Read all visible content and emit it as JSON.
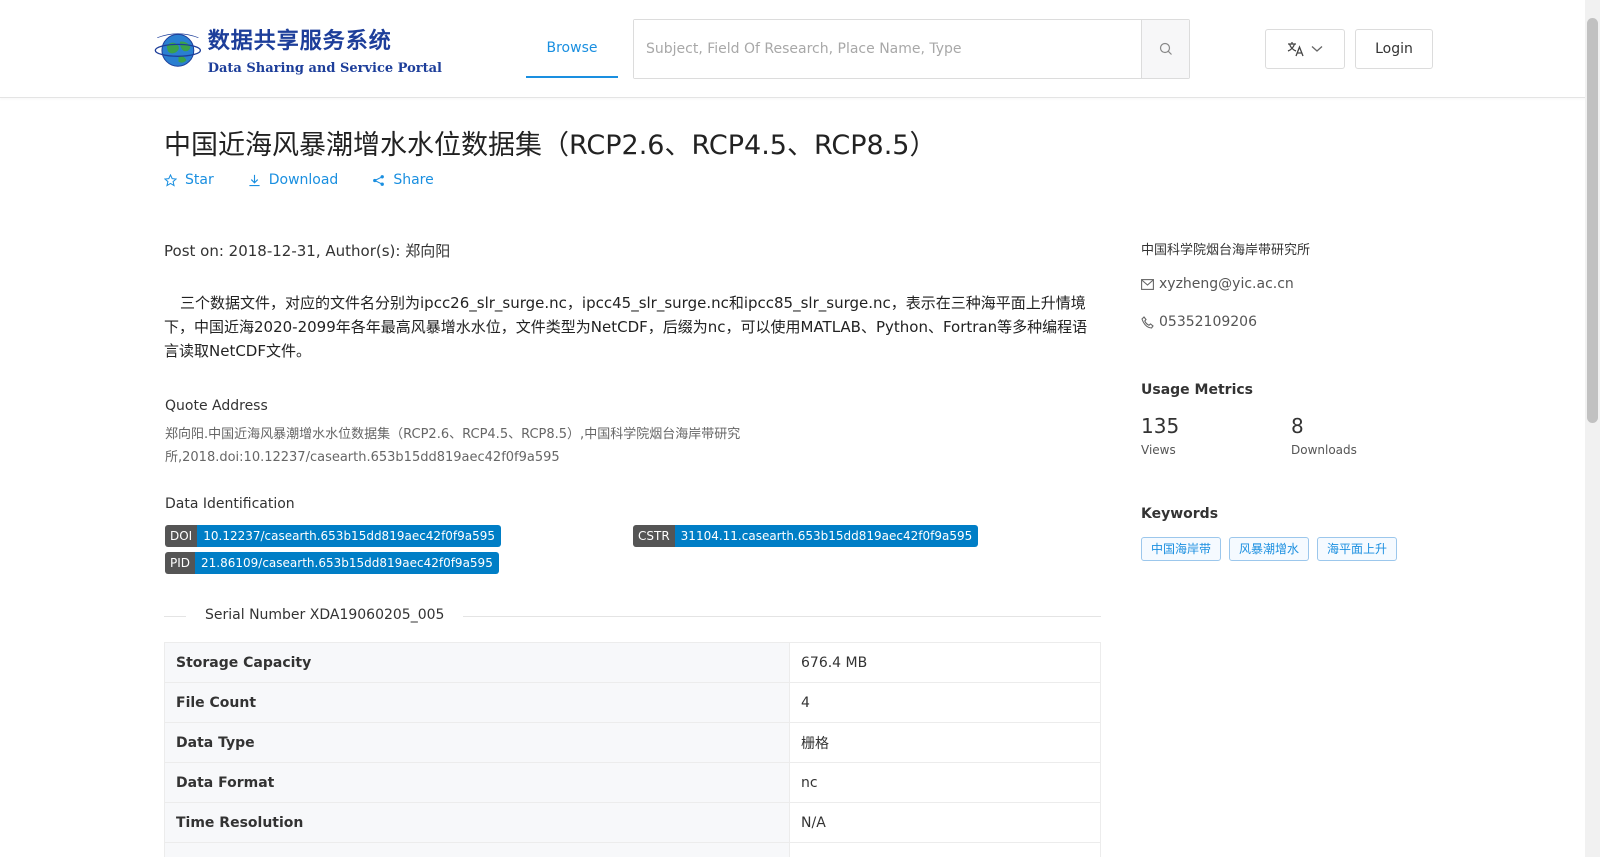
{
  "header": {
    "logo_cn": "数据共享服务系统",
    "logo_en": "Data Sharing and Service Portal",
    "nav_browse": "Browse",
    "search_placeholder": "Subject, Field Of Research, Place Name, Type",
    "login": "Login"
  },
  "dataset": {
    "title": "中国近海风暴潮增水水位数据集（RCP2.6、RCP4.5、RCP8.5）",
    "actions": {
      "star": "Star",
      "download": "Download",
      "share": "Share"
    },
    "post_on": "Post on: 2018-12-31, Author(s): 郑向阳",
    "description": "三个数据文件，对应的文件名分别为ipcc26_slr_surge.nc，ipcc45_slr_surge.nc和ipcc85_slr_surge.nc，表示在三种海平面上升情境下，中国近海2020-2099年各年最高风暴增水水位，文件类型为NetCDF，后缀为nc，可以使用MATLAB、Python、Fortran等多种编程语言读取NetCDF文件。",
    "quote_label": "Quote Address",
    "quote_text": "郑向阳.中国近海风暴潮增水水位数据集（RCP2.6、RCP4.5、RCP8.5）,中国科学院烟台海岸带研究所,2018.doi:10.12237/casearth.653b15dd819aec42f0f9a595",
    "identification_label": "Data Identification",
    "identifiers": {
      "doi": {
        "key": "DOI",
        "value": "10.12237/casearth.653b15dd819aec42f0f9a595"
      },
      "cstr": {
        "key": "CSTR",
        "value": "31104.11.casearth.653b15dd819aec42f0f9a595"
      },
      "pid": {
        "key": "PID",
        "value": "21.86109/casearth.653b15dd819aec42f0f9a595"
      }
    },
    "serial_number": "Serial Number XDA19060205_005",
    "properties": [
      {
        "key": "Storage Capacity",
        "value": "676.4 MB"
      },
      {
        "key": "File Count",
        "value": "4"
      },
      {
        "key": "Data Type",
        "value": "栅格"
      },
      {
        "key": "Data Format",
        "value": "nc"
      },
      {
        "key": "Time Resolution",
        "value": "N/A"
      }
    ]
  },
  "sidebar": {
    "organization": "中国科学院烟台海岸带研究所",
    "email": "xyzheng@yic.ac.cn",
    "phone": "05352109206",
    "usage_title": "Usage Metrics",
    "views_count": "135",
    "views_label": "Views",
    "downloads_count": "8",
    "downloads_label": "Downloads",
    "keywords_title": "Keywords",
    "keywords": [
      "中国海岸带",
      "风暴潮增水",
      "海平面上升"
    ]
  },
  "colors": {
    "accent": "#1a8fe0",
    "badge_key": "#555555",
    "badge_value": "#007ec6",
    "logo_blue": "#1d3e9a"
  },
  "icons": [
    "globe-logo-icon",
    "search-icon",
    "translate-icon",
    "chevron-down-icon",
    "star-icon",
    "download-icon",
    "share-icon",
    "mail-icon",
    "phone-icon"
  ]
}
